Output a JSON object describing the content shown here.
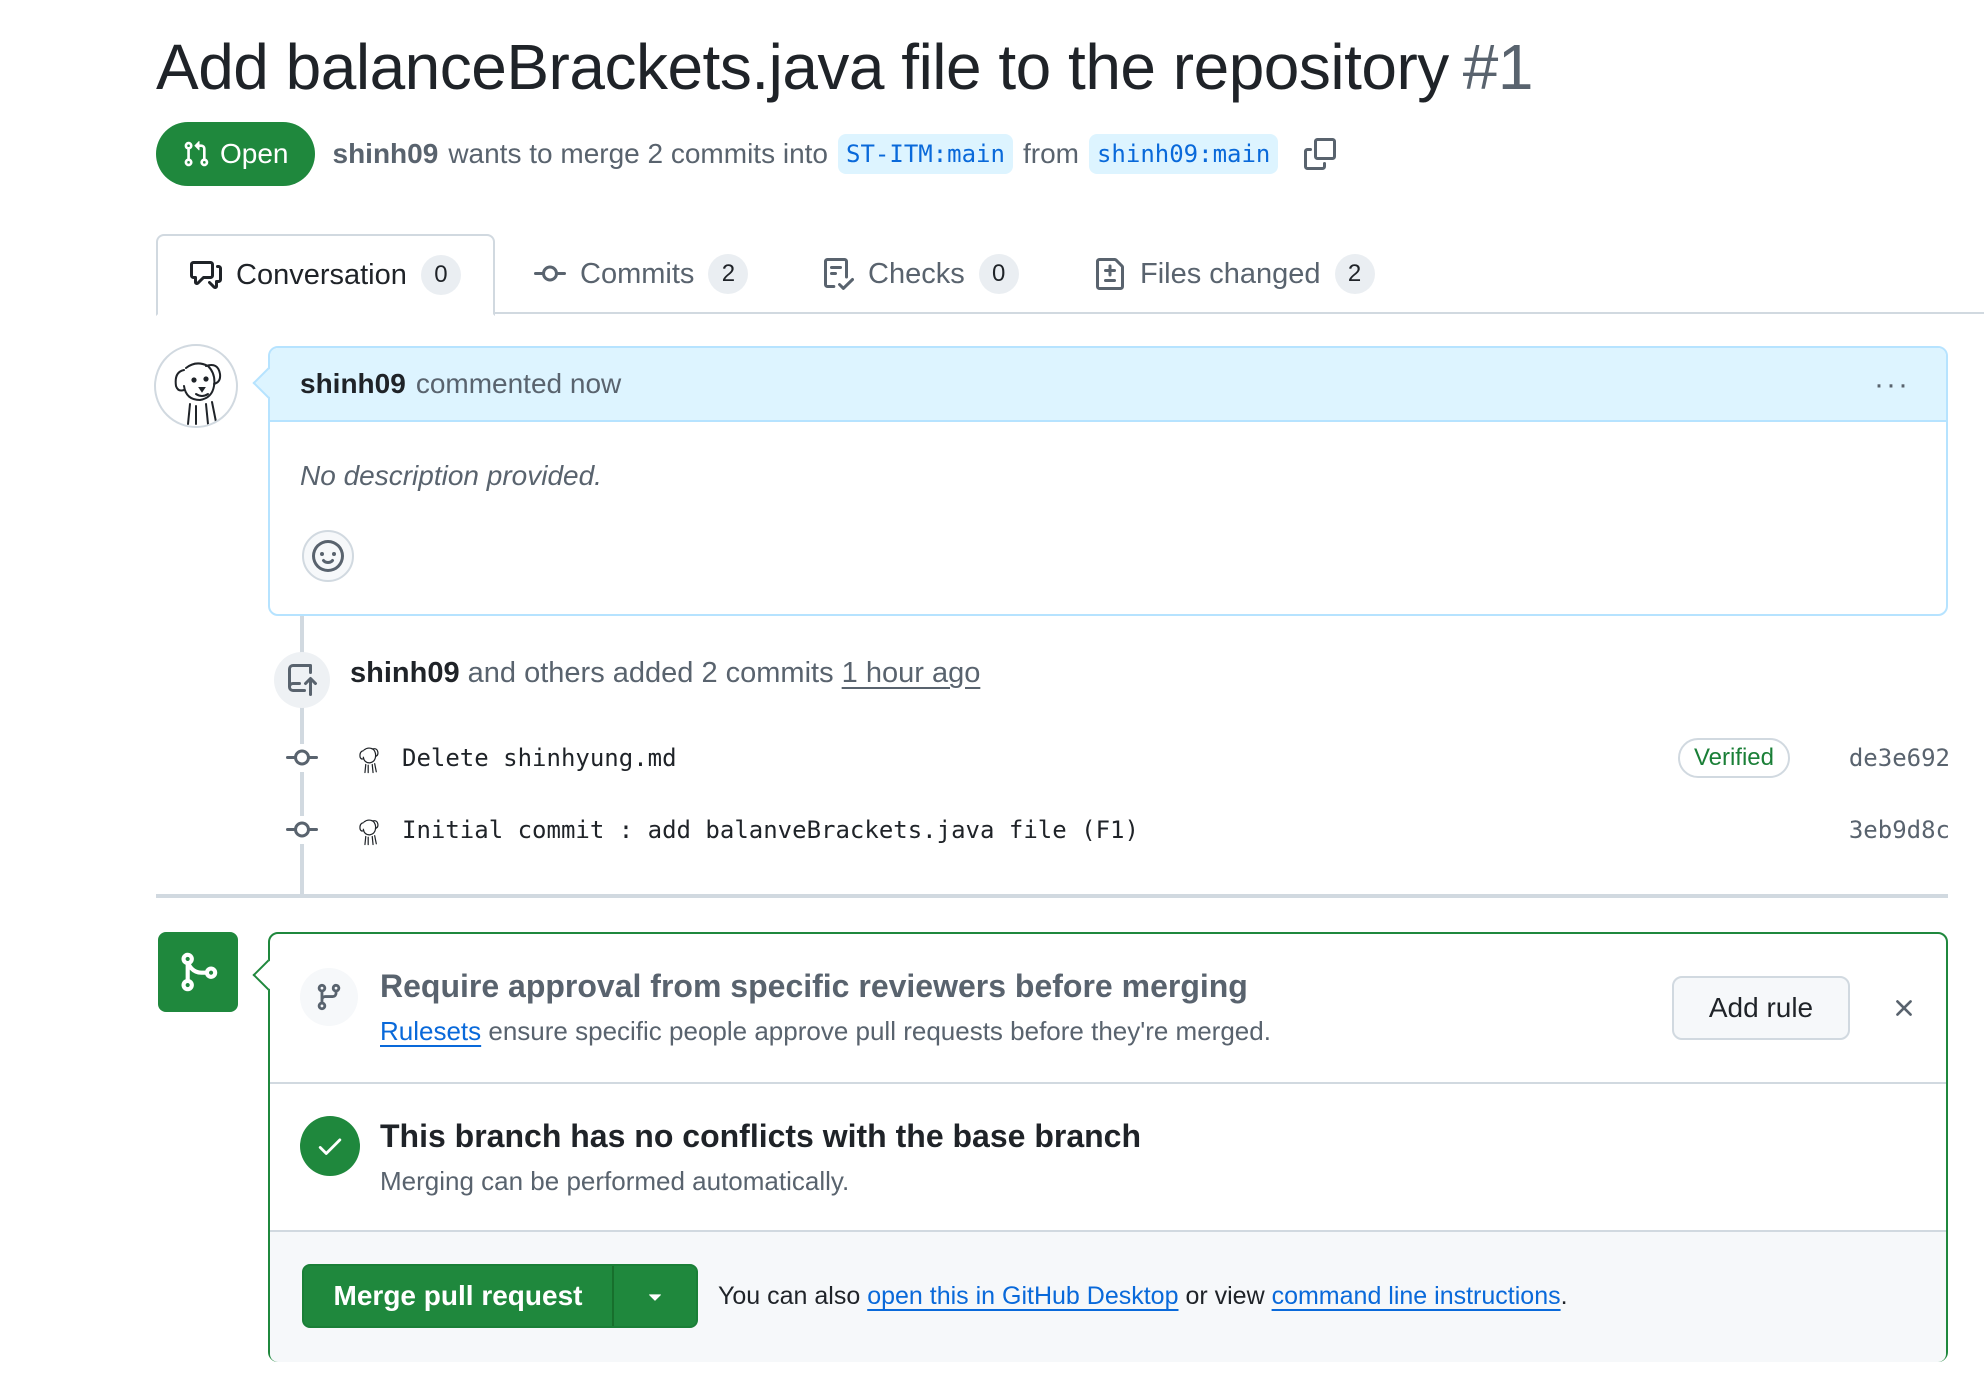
{
  "pr": {
    "title": "Add balanceBrackets.java file to the repository",
    "number": "#1",
    "state": "Open",
    "author": "shinh09",
    "merge_text": "wants to merge 2 commits into",
    "base_branch": "ST-ITM:main",
    "from_text": "from",
    "head_branch": "shinh09:main"
  },
  "tabs": [
    {
      "label": "Conversation",
      "count": "0",
      "icon": "comment-discussion-icon",
      "active": true
    },
    {
      "label": "Commits",
      "count": "2",
      "icon": "git-commit-icon"
    },
    {
      "label": "Checks",
      "count": "0",
      "icon": "checklist-icon"
    },
    {
      "label": "Files changed",
      "count": "2",
      "icon": "file-diff-icon"
    }
  ],
  "comment": {
    "author": "shinh09",
    "action": "commented now",
    "body": "No description provided.",
    "menu": "···"
  },
  "push_event": {
    "author": "shinh09",
    "text": "and others added 2 commits",
    "time": "1 hour ago"
  },
  "commits": [
    {
      "message": "Delete shinhyung.md",
      "verified": "Verified",
      "sha": "de3e692"
    },
    {
      "message": "Initial commit : add balanveBrackets.java file (F1)",
      "verified": "",
      "sha": "3eb9d8c"
    }
  ],
  "merge": {
    "ruleset_title": "Require approval from specific reviewers before merging",
    "ruleset_link": "Rulesets",
    "ruleset_desc": "ensure specific people approve pull requests before they're merged.",
    "add_rule": "Add rule",
    "status_title": "This branch has no conflicts with the base branch",
    "status_desc": "Merging can be performed automatically.",
    "merge_button": "Merge pull request",
    "note_prefix": "You can also",
    "desktop_link": "open this in GitHub Desktop",
    "note_middle": "or view",
    "cli_link": "command line instructions",
    "note_suffix": "."
  },
  "colors": {
    "green": "#1f883d",
    "blue": "#0969da",
    "muted": "#59636e",
    "header_blue": "#ddf4ff"
  }
}
